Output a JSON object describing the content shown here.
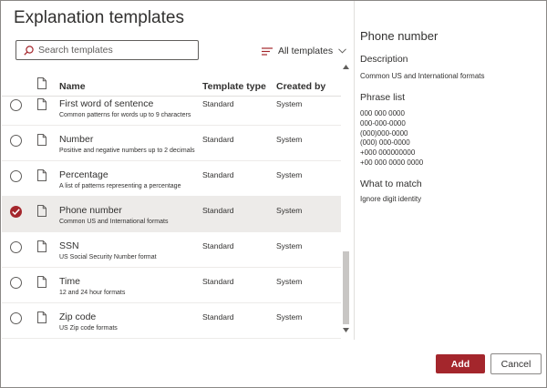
{
  "dialog": {
    "title": "Explanation templates"
  },
  "search": {
    "placeholder": "Search templates",
    "icon": "search-icon"
  },
  "filter": {
    "label": "All templates",
    "icon": "filter-lines-icon"
  },
  "table": {
    "columns": {
      "name": "Name",
      "type": "Template type",
      "created_by": "Created by"
    },
    "rows": [
      {
        "name": "First word of sentence",
        "description": "Common patterns for words up to 9 characters",
        "type": "Standard",
        "created_by": "System",
        "selected": false
      },
      {
        "name": "Number",
        "description": "Positive and negative numbers up to 2 decimals",
        "type": "Standard",
        "created_by": "System",
        "selected": false
      },
      {
        "name": "Percentage",
        "description": "A list of patterns representing a percentage",
        "type": "Standard",
        "created_by": "System",
        "selected": false
      },
      {
        "name": "Phone number",
        "description": "Common US and International formats",
        "type": "Standard",
        "created_by": "System",
        "selected": true
      },
      {
        "name": "SSN",
        "description": "US Social Security Number format",
        "type": "Standard",
        "created_by": "System",
        "selected": false
      },
      {
        "name": "Time",
        "description": "12 and 24 hour formats",
        "type": "Standard",
        "created_by": "System",
        "selected": false
      },
      {
        "name": "Zip code",
        "description": "US Zip code formats",
        "type": "Standard",
        "created_by": "System",
        "selected": false
      }
    ]
  },
  "detail": {
    "title": "Phone number",
    "description_heading": "Description",
    "description": "Common US and International formats",
    "phrase_list_heading": "Phrase list",
    "phrases": [
      "000 000 0000",
      "000-000-0000",
      "(000)000-0000",
      "(000) 000-0000",
      "+000 000000000",
      "+00 000 0000 0000"
    ],
    "what_to_match_heading": "What to match",
    "what_to_match": "Ignore digit identity"
  },
  "footer": {
    "add_label": "Add",
    "cancel_label": "Cancel"
  },
  "colors": {
    "accent": "#a4262c",
    "selected_row": "#edebe9",
    "border": "#8a8886"
  }
}
